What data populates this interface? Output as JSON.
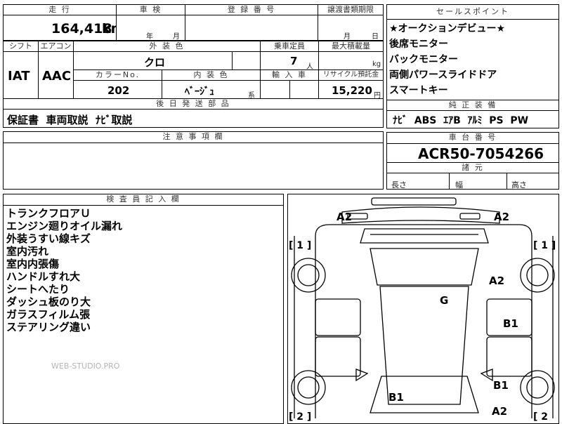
{
  "top": {
    "hdr_mileage": "走 行",
    "hdr_inspection": "車 検",
    "hdr_registration": "登 録 番 号",
    "hdr_transfer": "譲渡書類期限",
    "mileage_value": "164,418",
    "mileage_unit": "km",
    "inspection_year": "年",
    "inspection_month": "月",
    "registration_value": "",
    "transfer_month": "月",
    "transfer_day": "日"
  },
  "row2": {
    "hdr_shift": "シフト",
    "hdr_aircon": "エアコン",
    "hdr_exterior": "外 装 色",
    "hdr_capacity": "乗車定員",
    "hdr_maxload": "最大積載量",
    "shift_value": "IAT",
    "aircon_value": "AAC",
    "exterior_value": "クロ",
    "capacity_value": "7",
    "capacity_unit": "人",
    "maxload_unit": "kg",
    "hdr_color_no": "カラーNo.",
    "hdr_interior": "内 装 色",
    "hdr_import": "輸 入 車",
    "hdr_recycle": "リサイクル預託金",
    "color_no_value": "202",
    "interior_value": "ﾍﾞｰｼﾞｭ",
    "interior_suffix": "系",
    "recycle_value": "15,220",
    "recycle_unit": "円"
  },
  "later_parts": {
    "header": "後 日 発 送 部 品",
    "value": "保証書  車両取説  ﾅﾋﾞ取説"
  },
  "notes": {
    "header": "注 意 事 項 欄",
    "value": ""
  },
  "sales_points": {
    "header": "セールスポイント",
    "items": [
      "★オークションデビュー★",
      "後席モニター",
      "バックモニター",
      "両側パワースライドドア",
      "スマートキー"
    ]
  },
  "equipment": {
    "header": "純 正 装 備",
    "value": "ﾅﾋﾞ  ABS  ｴｱB  ｱﾙﾐ  PS  PW"
  },
  "chassis": {
    "header": "車 台 番 号",
    "value": "ACR50-7054266"
  },
  "dimensions": {
    "header": "諸 元",
    "length_label": "長さ",
    "width_label": "幅",
    "height_label": "高さ"
  },
  "inspector": {
    "header": "検 査 員 記 入 欄",
    "lines": [
      "トランクフロアＵ",
      "エンジン廻りオイル漏れ",
      "外装うすい線キズ",
      "室内汚れ",
      "室内内張傷",
      "ハンドルすれ大",
      "シートへたり",
      "ダッシュ板のり大",
      "ガラスフィルム張",
      "ステアリング違い"
    ],
    "watermark": "WEB-STUDIO.PRO"
  },
  "diagram": {
    "marks": [
      "A2",
      "A2",
      "A2",
      "G",
      "B1",
      "B1",
      "B1",
      "A2"
    ],
    "bracket_labels": [
      "[ 1 ]",
      "[ 1 ]",
      "[ 2 ]",
      "[ 2"
    ]
  }
}
